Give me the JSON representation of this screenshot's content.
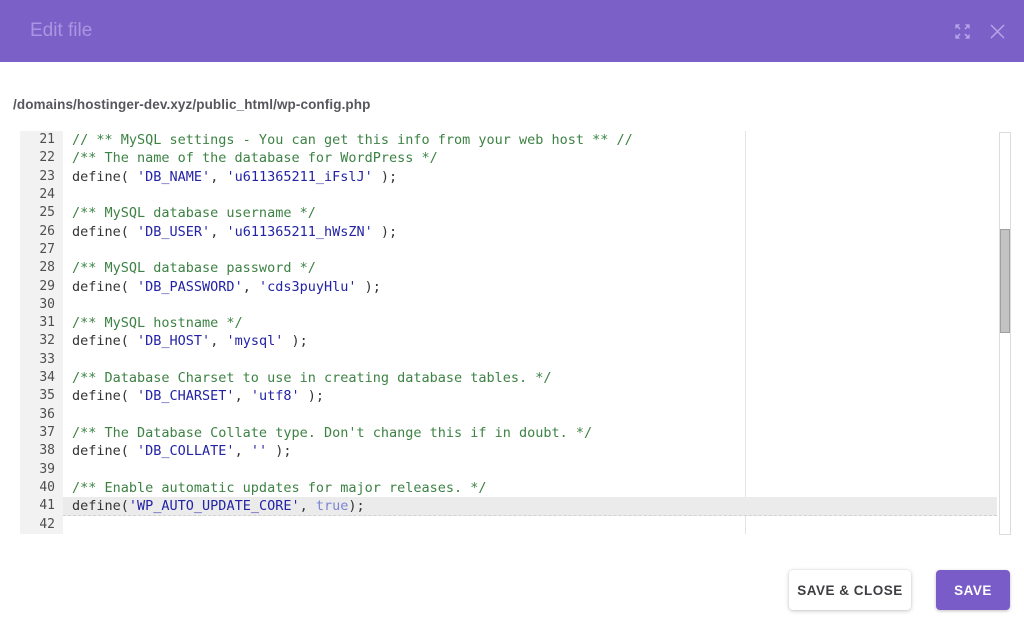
{
  "header": {
    "title": "Edit file"
  },
  "file_path": "/domains/hostinger-dev.xyz/public_html/wp-config.php",
  "editor": {
    "ruler_column": 80,
    "first_line_number": 21,
    "active_line_number": 41,
    "lines": [
      {
        "n": 21,
        "parts": [
          [
            "comment",
            "// ** MySQL settings - You can get this info from your web host ** //"
          ]
        ]
      },
      {
        "n": 22,
        "parts": [
          [
            "comment",
            "/** The name of the database for WordPress */"
          ]
        ]
      },
      {
        "n": 23,
        "parts": [
          [
            "plain",
            "define( "
          ],
          [
            "string",
            "'DB_NAME'"
          ],
          [
            "plain",
            ", "
          ],
          [
            "string",
            "'u611365211_iFslJ'"
          ],
          [
            "plain",
            " );"
          ]
        ]
      },
      {
        "n": 24,
        "parts": []
      },
      {
        "n": 25,
        "parts": [
          [
            "comment",
            "/** MySQL database username */"
          ]
        ]
      },
      {
        "n": 26,
        "parts": [
          [
            "plain",
            "define( "
          ],
          [
            "string",
            "'DB_USER'"
          ],
          [
            "plain",
            ", "
          ],
          [
            "string",
            "'u611365211_hWsZN'"
          ],
          [
            "plain",
            " );"
          ]
        ]
      },
      {
        "n": 27,
        "parts": []
      },
      {
        "n": 28,
        "parts": [
          [
            "comment",
            "/** MySQL database password */"
          ]
        ]
      },
      {
        "n": 29,
        "parts": [
          [
            "plain",
            "define( "
          ],
          [
            "string",
            "'DB_PASSWORD'"
          ],
          [
            "plain",
            ", "
          ],
          [
            "string",
            "'cds3puyHlu'"
          ],
          [
            "plain",
            " );"
          ]
        ]
      },
      {
        "n": 30,
        "parts": []
      },
      {
        "n": 31,
        "parts": [
          [
            "comment",
            "/** MySQL hostname */"
          ]
        ]
      },
      {
        "n": 32,
        "parts": [
          [
            "plain",
            "define( "
          ],
          [
            "string",
            "'DB_HOST'"
          ],
          [
            "plain",
            ", "
          ],
          [
            "string",
            "'mysql'"
          ],
          [
            "plain",
            " );"
          ]
        ]
      },
      {
        "n": 33,
        "parts": []
      },
      {
        "n": 34,
        "parts": [
          [
            "comment",
            "/** Database Charset to use in creating database tables. */"
          ]
        ]
      },
      {
        "n": 35,
        "parts": [
          [
            "plain",
            "define( "
          ],
          [
            "string",
            "'DB_CHARSET'"
          ],
          [
            "plain",
            ", "
          ],
          [
            "string",
            "'utf8'"
          ],
          [
            "plain",
            " );"
          ]
        ]
      },
      {
        "n": 36,
        "parts": []
      },
      {
        "n": 37,
        "parts": [
          [
            "comment",
            "/** The Database Collate type. Don't change this if in doubt. */"
          ]
        ]
      },
      {
        "n": 38,
        "parts": [
          [
            "plain",
            "define( "
          ],
          [
            "string",
            "'DB_COLLATE'"
          ],
          [
            "plain",
            ", "
          ],
          [
            "string",
            "''"
          ],
          [
            "plain",
            " );"
          ]
        ]
      },
      {
        "n": 39,
        "parts": []
      },
      {
        "n": 40,
        "parts": [
          [
            "comment",
            "/** Enable automatic updates for major releases. */"
          ]
        ]
      },
      {
        "n": 41,
        "active": true,
        "parts": [
          [
            "plain",
            "define("
          ],
          [
            "string",
            "'WP_AUTO_UPDATE_CORE'"
          ],
          [
            "plain",
            ", "
          ],
          [
            "atom",
            "true"
          ],
          [
            "plain",
            ");"
          ]
        ]
      },
      {
        "n": 42,
        "parts": []
      }
    ]
  },
  "footer": {
    "save_close_label": "SAVE & CLOSE",
    "save_label": "SAVE"
  },
  "colors": {
    "header_bg": "#7b60c7",
    "header_title": "#a996e2",
    "header_icon": "#b5a6e8",
    "accent": "#7a5cc8",
    "comment": "#3d8244",
    "string": "#2323a6",
    "atom": "#7a85d2",
    "plain": "#333333"
  }
}
